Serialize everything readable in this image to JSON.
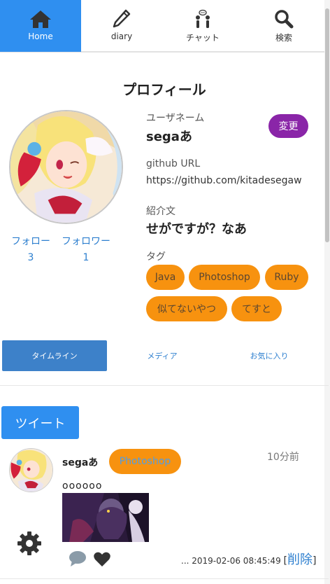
{
  "nav": {
    "items": [
      {
        "label": "Home",
        "icon": "home-icon",
        "active": true
      },
      {
        "label": "diary",
        "icon": "pencil-icon",
        "active": false
      },
      {
        "label": "チャット",
        "icon": "chat-people-icon",
        "active": false
      },
      {
        "label": "検索",
        "icon": "search-icon",
        "active": false
      }
    ]
  },
  "profile": {
    "title": "プロフィール",
    "username_label": "ユーザネーム",
    "username": "segaあ",
    "change_label": "変更",
    "github_label": "github URL",
    "github_url": "https://github.com/kitadesegaw",
    "intro_label": "紹介文",
    "intro": "せがですが？なあ",
    "tags_label": "タグ",
    "tags": [
      "Java",
      "Photoshop",
      "Ruby",
      "似てないやつ",
      "てすと"
    ],
    "follow_label": "フォロー",
    "follow_count": "3",
    "follower_label": "フォロワー",
    "follower_count": "1"
  },
  "tabs": [
    "タイムライン",
    "メディア",
    "お気に入り"
  ],
  "tweet_button": "ツイート",
  "tweet": {
    "user": "segaあ",
    "tag": "Photoshop",
    "relative_time": "10分前",
    "text": "oooooo",
    "date": "... 2019-02-06 08:45:49",
    "delete_label": "削除"
  },
  "colors": {
    "accent": "#2f8ff0",
    "tag_orange": "#f7920f",
    "change_purple": "#8a25a8",
    "link_blue": "#2d7fcf"
  }
}
